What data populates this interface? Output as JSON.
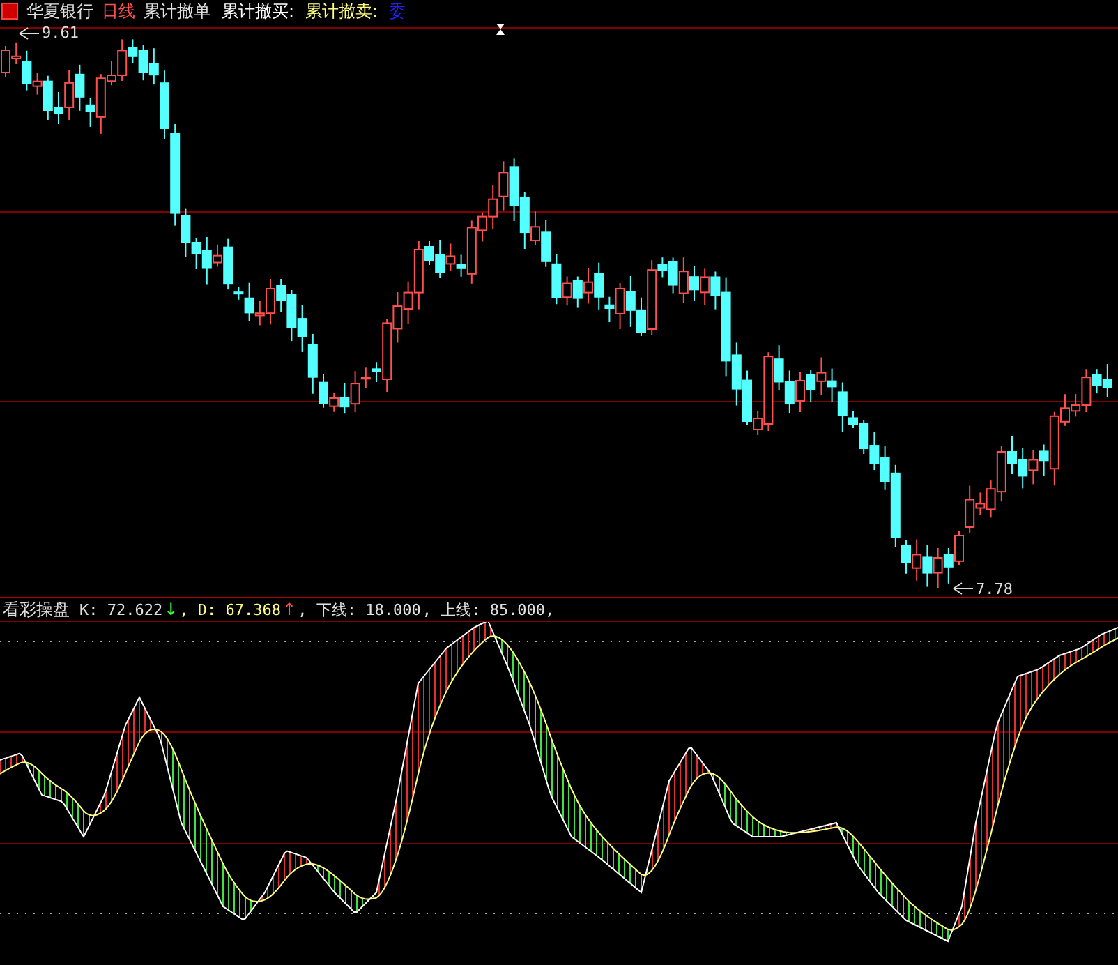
{
  "price_panel": {
    "legend": [
      {
        "kind": "name",
        "text": "华夏银行",
        "color": "#e0e0e0"
      },
      {
        "kind": "period",
        "text": "日线",
        "color": "#ff5050"
      },
      {
        "kind": "indicator",
        "text": "累计撤单",
        "color": "#e0e0e0"
      },
      {
        "kind": "field",
        "text": "累计撤买:",
        "color": "#ffffff"
      },
      {
        "kind": "field",
        "text": "累计撤卖:",
        "color": "#ffff80"
      },
      {
        "kind": "field",
        "text": "委",
        "color": "#2020ff"
      }
    ],
    "high_label": "9.61",
    "low_label": "7.78"
  },
  "indicator_panel": {
    "title": "看彩操盘",
    "items": [
      {
        "text": "K: 72.622",
        "kind": "plain",
        "arrow": "↓"
      },
      {
        "text": ", D: 67.368",
        "kind": "highlight",
        "arrow": "↑"
      },
      {
        "text": ", 下线: 18.000",
        "kind": "plain"
      },
      {
        "text": ", 上线: 85.000,",
        "kind": "plain"
      }
    ]
  }
}
